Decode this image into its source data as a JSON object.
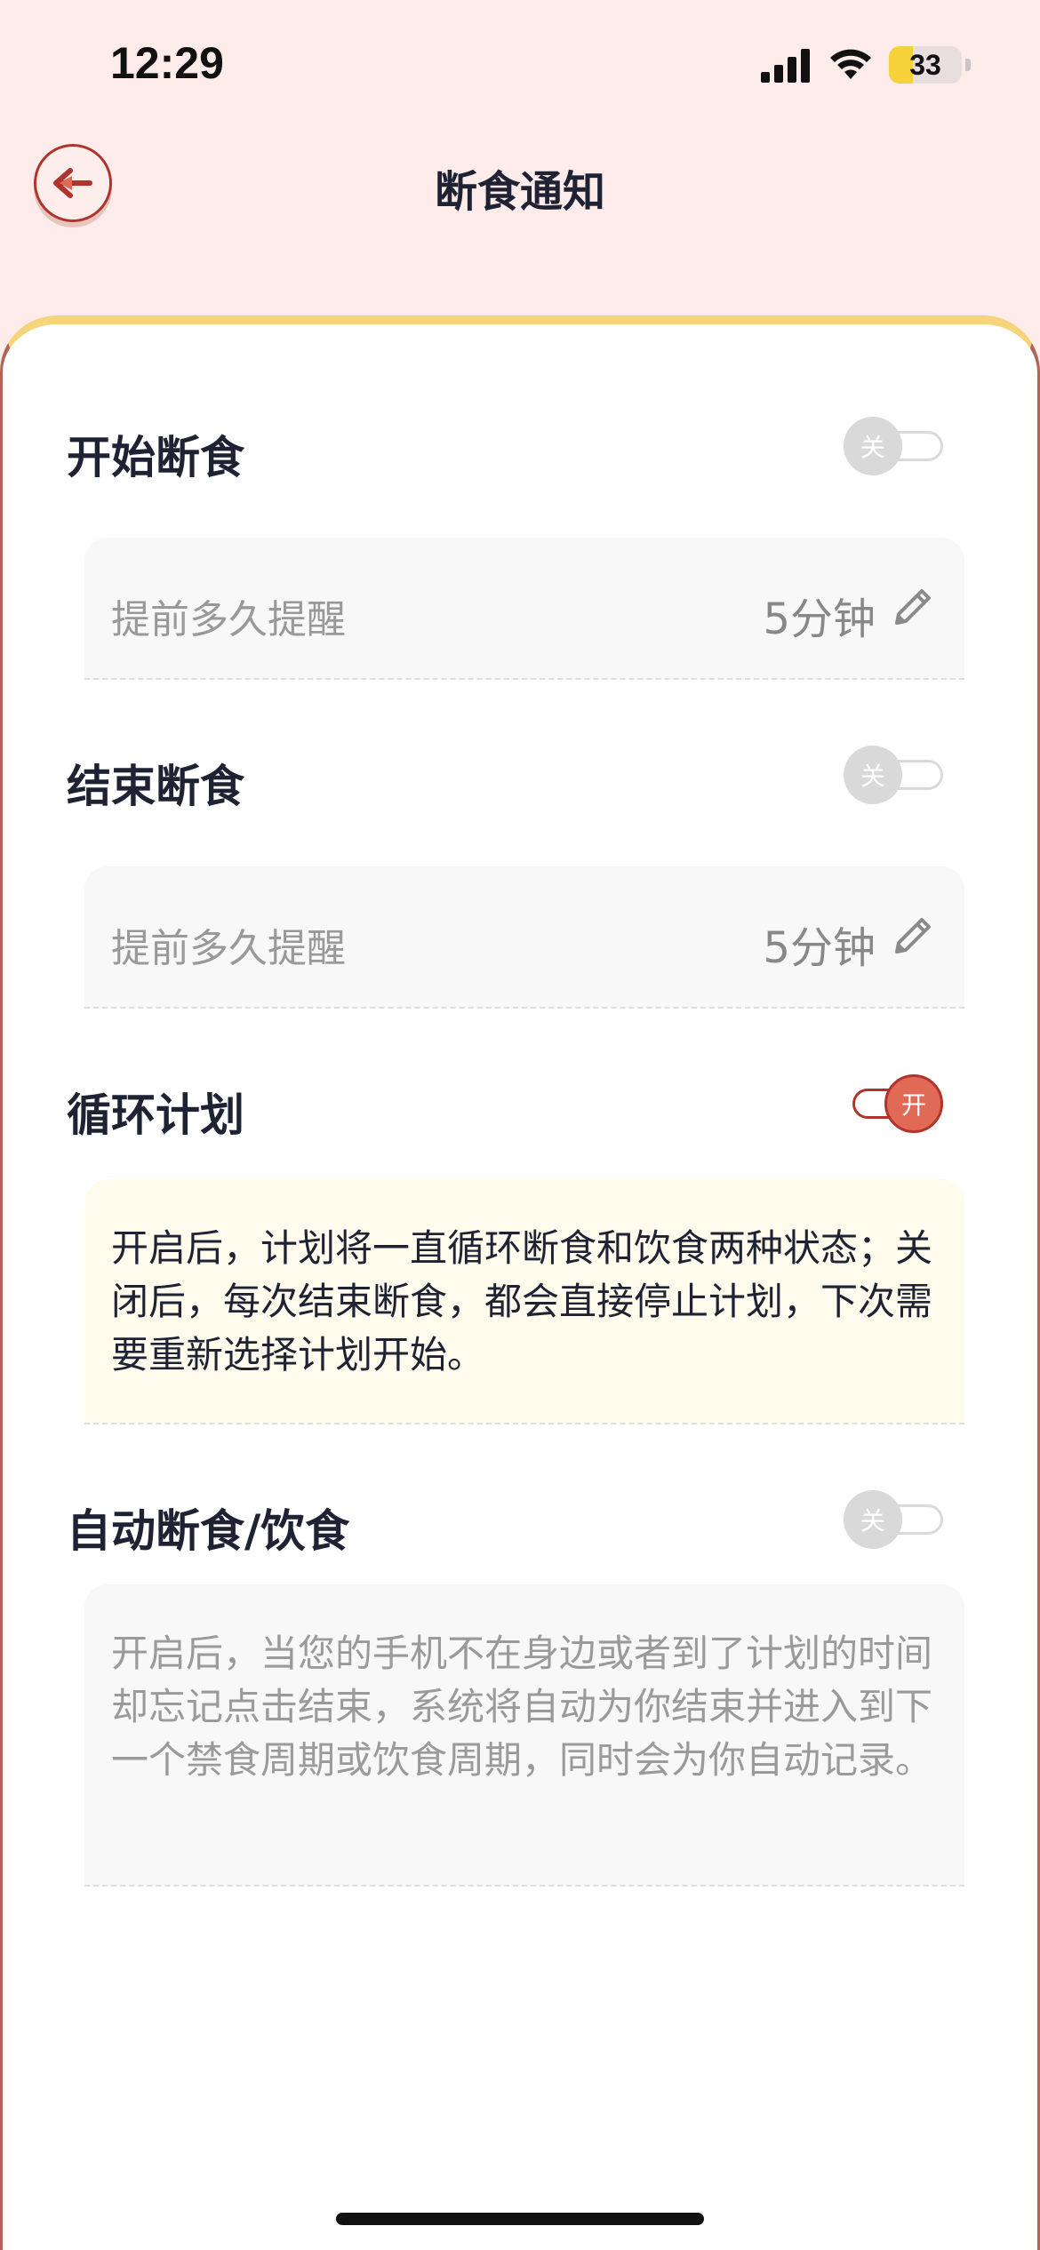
{
  "status_bar": {
    "time": "12:29",
    "battery_level": "33",
    "battery_fraction": 0.33,
    "icons": [
      "cellular-signal-icon",
      "wifi-icon",
      "battery-icon"
    ]
  },
  "header": {
    "title": "断食通知",
    "back_icon": "arrow-left-icon"
  },
  "sections": {
    "start_fast": {
      "title": "开始断食",
      "toggle_state": "关",
      "reminder_label": "提前多久提醒",
      "reminder_value": "5分钟"
    },
    "end_fast": {
      "title": "结束断食",
      "toggle_state": "关",
      "reminder_label": "提前多久提醒",
      "reminder_value": "5分钟"
    },
    "cycle_plan": {
      "title": "循环计划",
      "toggle_state": "开",
      "description": "开启后，计划将一直循环断食和饮食两种状态；关闭后，每次结束断食，都会直接停止计划，下次需要重新选择计划开始。"
    },
    "auto_fast": {
      "title": "自动断食/饮食",
      "toggle_state": "关",
      "description": "开启后，当您的手机不在身边或者到了计划的时间却忘记点击结束，系统将自动为你结束并进入到下一个禁食周期或饮食周期，同时会为你自动记录。"
    }
  },
  "colors": {
    "background": "#fdecea",
    "accent": "#e06a55",
    "accent_border": "#b0342b",
    "card_top_border": "#f6d57a",
    "toggle_off": "#d9d9d9",
    "note_background": "#fffcee"
  }
}
